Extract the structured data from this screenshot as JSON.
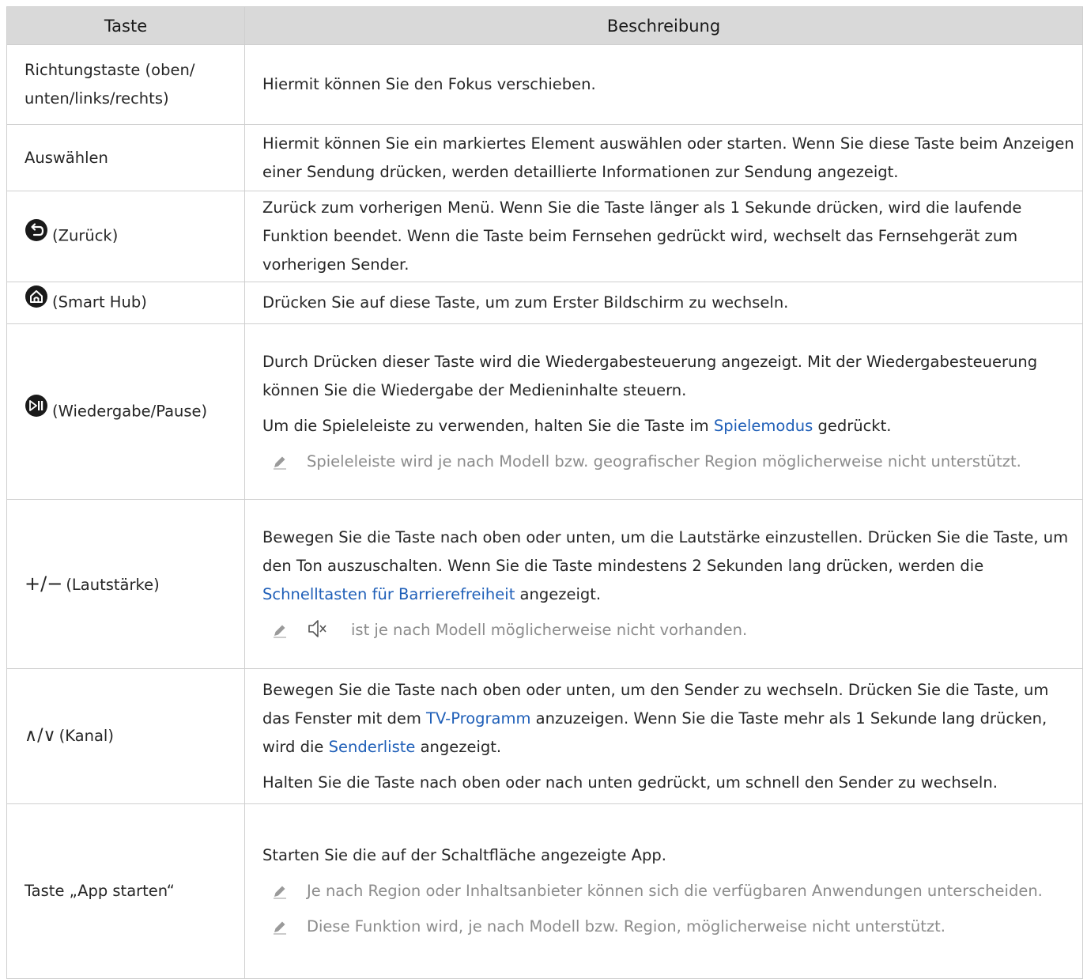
{
  "header": {
    "col_key": "Taste",
    "col_desc": "Beschreibung"
  },
  "rows": [
    {
      "key": "Richtungstaste (oben/ unten/links/rechts)",
      "desc": "Hiermit können Sie den Fokus verschieben."
    },
    {
      "key": "Auswählen",
      "desc": "Hiermit können Sie ein markiertes Element auswählen oder starten. Wenn Sie diese Taste beim Anzeigen einer Sendung drücken, werden detaillierte Informationen zur Sendung angezeigt."
    },
    {
      "key": "(Zurück)",
      "icon": "back-icon",
      "desc": "Zurück zum vorherigen Menü. Wenn Sie die Taste länger als 1 Sekunde drücken, wird die laufende Funktion beendet. Wenn die Taste beim Fernsehen gedrückt wird, wechselt das Fernsehgerät zum vorherigen Sender."
    },
    {
      "key": "(Smart Hub)",
      "icon": "home-icon",
      "desc": "Drücken Sie auf diese Taste, um zum Erster Bildschirm zu wechseln."
    },
    {
      "key": "(Wiedergabe/Pause)",
      "icon": "play-pause-icon",
      "desc": "Durch Drücken dieser Taste wird die Wiedergabesteuerung angezeigt. Mit der Wiedergabesteuerung können Sie die Wiedergabe der Medieninhalte steuern.",
      "desc2_pre": "Um die Spieleleiste zu verwenden, halten Sie die Taste im ",
      "desc2_link": "Spielemodus",
      "desc2_post": " gedrückt.",
      "note": "Spieleleiste wird je nach Modell bzw. geografischer Region möglicherweise nicht unterstützt."
    },
    {
      "key": "(Lautstärke)",
      "key_symbols": "+/−",
      "desc_pre": "Bewegen Sie die Taste nach oben oder unten, um die Lautstärke einzustellen. Drücken Sie die Taste, um den Ton auszuschalten. Wenn Sie die Taste mindestens 2 Sekunden lang drücken, werden die ",
      "desc_link": "Schnelltasten für Barrierefreiheit",
      "desc_post": " angezeigt.",
      "note": "ist je nach Modell möglicherweise nicht vorhanden."
    },
    {
      "key": "(Kanal)",
      "key_symbols": "∧/∨",
      "desc_pre": "Bewegen Sie die Taste nach oben oder unten, um den Sender zu wechseln. Drücken Sie die Taste, um das Fenster mit dem ",
      "desc_link1": "TV-Programm",
      "desc_mid": " anzuzeigen. Wenn Sie die Taste mehr als 1 Sekunde lang drücken, wird die ",
      "desc_link2": "Senderliste",
      "desc_post": " angezeigt.",
      "desc2": "Halten Sie die Taste nach oben oder nach unten gedrückt, um schnell den Sender zu wechseln."
    },
    {
      "key": "Taste „App starten“",
      "desc": "Starten Sie die auf der Schaltfläche angezeigte App.",
      "note1": "Je nach Region oder Inhaltsanbieter können sich die verfügbaren Anwendungen unterscheiden.",
      "note2": "Diese Funktion wird, je nach Modell bzw. Region, möglicherweise nicht unterstützt."
    }
  ],
  "colors": {
    "header_bg": "#d9d9d9",
    "link": "#1f5fb8",
    "note_text": "#8c8c8c",
    "border": "#cfcfcf"
  }
}
